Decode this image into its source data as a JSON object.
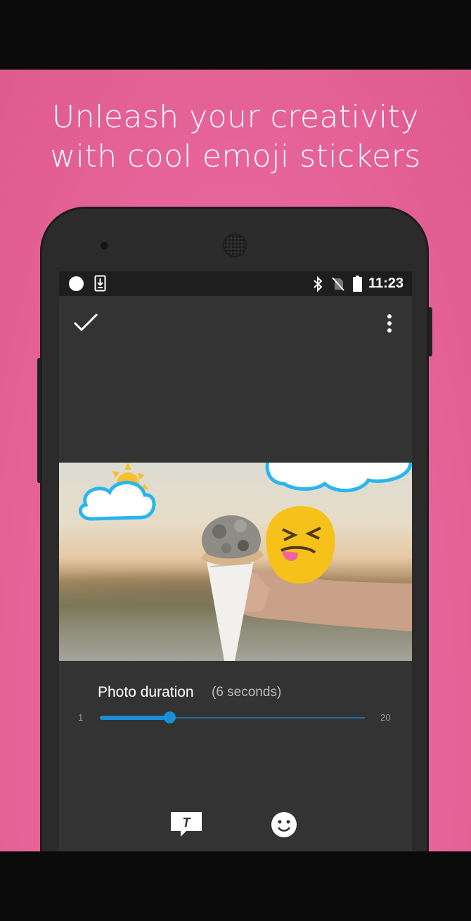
{
  "promo": {
    "headline_line1": "Unleash your creativity",
    "headline_line2": "with cool emoji stickers",
    "background_color": "#e8689f"
  },
  "status_bar": {
    "time": "11:23",
    "icons": [
      "notification-dot-icon",
      "download-icon",
      "bluetooth-icon",
      "no-sim-icon",
      "battery-icon"
    ]
  },
  "toolbar": {
    "confirm_icon": "checkmark-icon",
    "menu_icon": "more-vert-icon"
  },
  "photo": {
    "stickers": [
      "sun-cloud-sticker",
      "cloud-sticker",
      "squinting-tongue-emoji-sticker"
    ]
  },
  "duration": {
    "label": "Photo duration",
    "value_text": "(6 seconds)",
    "min": "1",
    "max": "20",
    "value": 6,
    "accent": "#1a8fd6"
  },
  "bottom_tools": {
    "text_tool_icon": "text-bubble-icon",
    "sticker_tool_icon": "smiley-face-icon"
  }
}
